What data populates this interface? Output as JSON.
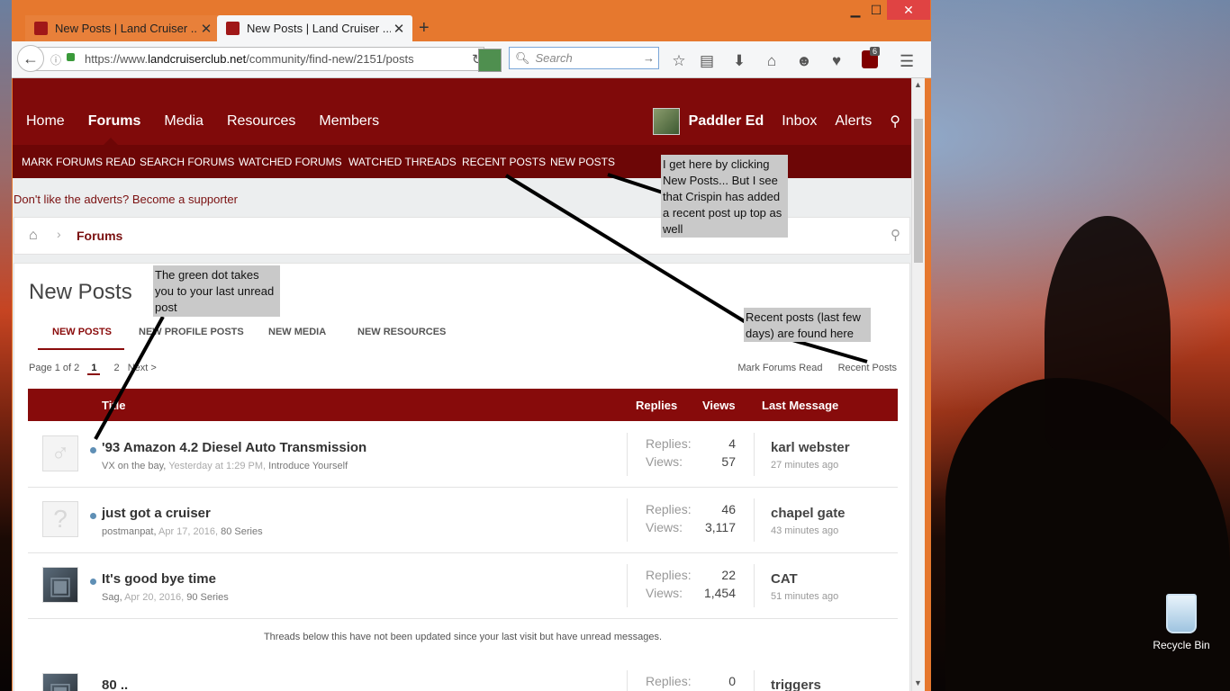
{
  "browser": {
    "tabs": [
      {
        "title": "New Posts | Land Cruiser ...",
        "active": false
      },
      {
        "title": "New Posts | Land Cruiser ...",
        "active": true
      }
    ],
    "url_scheme": "https://www.",
    "url_domain": "landcruiserclub.net",
    "url_path": "/community/find-new/2151/posts",
    "search_placeholder": "Search",
    "ublock_count": "6"
  },
  "site": {
    "main_nav": [
      "Home",
      "Forums",
      "Media",
      "Resources",
      "Members"
    ],
    "active_nav": "Forums",
    "username": "Paddler Ed",
    "inbox": "Inbox",
    "alerts": "Alerts",
    "sub_nav": [
      "MARK FORUMS READ",
      "SEARCH FORUMS",
      "WATCHED FORUMS",
      "WATCHED THREADS",
      "RECENT POSTS",
      "NEW POSTS"
    ],
    "advert_text": "Don't like the adverts? Become a supporter",
    "breadcrumb": "Forums"
  },
  "page": {
    "title": "New Posts",
    "tabs": [
      "NEW POSTS",
      "NEW PROFILE POSTS",
      "NEW MEDIA",
      "NEW RESOURCES"
    ],
    "pager_label": "Page 1 of 2",
    "pager_current": "1",
    "pager_next_num": "2",
    "pager_next": "Next >",
    "mark_read": "Mark Forums Read",
    "recent_posts": "Recent Posts",
    "columns": {
      "title": "Title",
      "replies": "Replies",
      "views": "Views",
      "last": "Last Message"
    },
    "replies_label": "Replies:",
    "views_label": "Views:",
    "threads": [
      {
        "title": "'93 Amazon 4.2 Diesel Auto Transmission",
        "author": "VX on the bay,",
        "date": "Yesterday at 1:29 PM,",
        "forum": "Introduce Yourself",
        "replies": "4",
        "views": "57",
        "last_user": "karl webster",
        "last_time": "27 minutes ago",
        "avatar_icon": "male-symbol-icon"
      },
      {
        "title": "just got a cruiser",
        "author": "postmanpat,",
        "date": "Apr 17, 2016,",
        "forum": "80 Series",
        "replies": "46",
        "views": "3,117",
        "last_user": "chapel gate",
        "last_time": "43 minutes ago",
        "avatar_icon": "question-mark-icon"
      },
      {
        "title": "It's good bye time",
        "author": "Sag,",
        "date": "Apr 20, 2016,",
        "forum": "90 Series",
        "replies": "22",
        "views": "1,454",
        "last_user": "CAT",
        "last_time": "51 minutes ago",
        "avatar_icon": "vehicle-photo-icon"
      }
    ],
    "notice": "Threads below this have not been updated since your last visit but have unread messages.",
    "partial_row": {
      "title": "80 ..",
      "replies": "0",
      "last_user": "triggers"
    }
  },
  "annotations": {
    "new_posts_note": "I get here by clicking New Posts... But I see that Crispin has added a recent post up top as well",
    "green_dot_note": "The green dot takes you to your last unread post",
    "recent_posts_note": "Recent posts (last few days) are found here"
  },
  "desktop": {
    "recycle_bin": "Recycle Bin"
  },
  "colors": {
    "brand": "#800a0a",
    "subnav": "#6d0606",
    "browser_chrome": "#e6782e",
    "annotation_bg": "#c9c9c9",
    "unread_dot": "#5f8fb5"
  }
}
